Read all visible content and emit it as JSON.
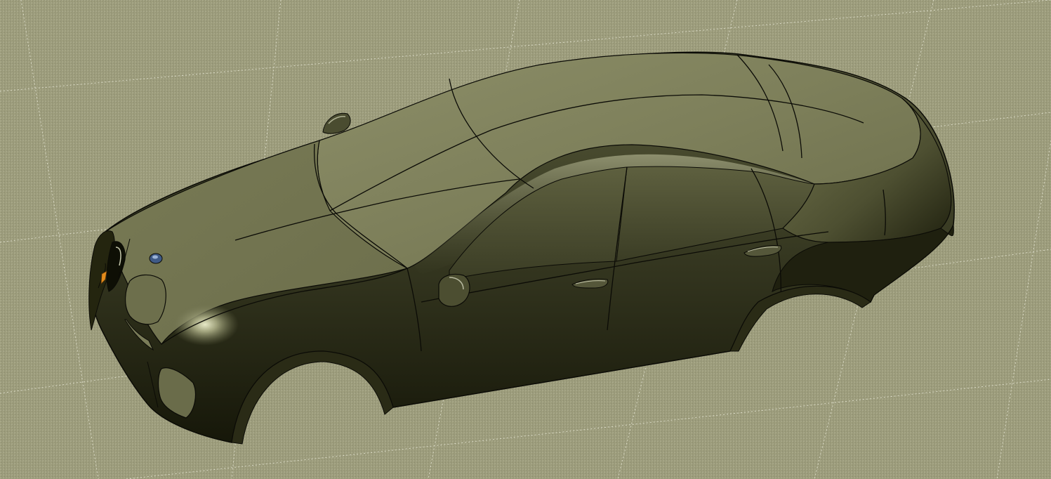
{
  "viewport": {
    "background_color": "#9a9a7a",
    "grid_color": "#e8e8d8",
    "model_base_color": "#6f7150",
    "model_highlight_color": "#c9caa6",
    "model_shadow_color": "#1d1e10",
    "edge_color": "#0b0b06",
    "grid_shown": true,
    "render_mode": "shaded-with-edges",
    "model_icon": "car-body-surface-icon"
  }
}
